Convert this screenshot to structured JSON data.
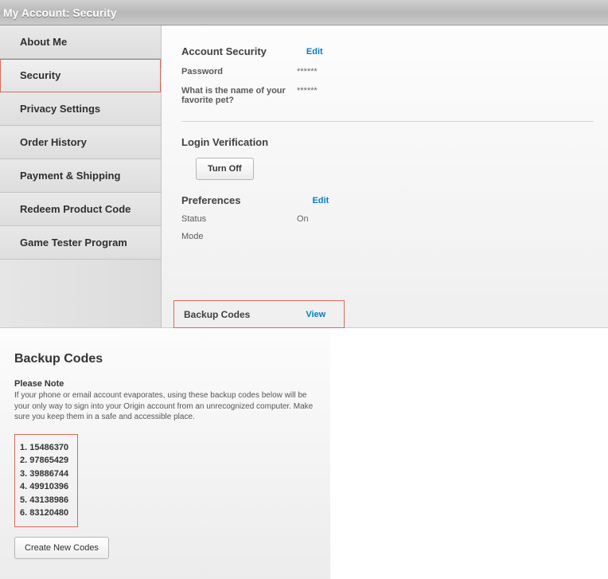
{
  "header": {
    "title": "My Account: Security"
  },
  "sidebar": {
    "items": [
      {
        "label": "About Me"
      },
      {
        "label": "Security"
      },
      {
        "label": "Privacy Settings"
      },
      {
        "label": "Order History"
      },
      {
        "label": "Payment & Shipping"
      },
      {
        "label": "Redeem Product Code"
      },
      {
        "label": "Game Tester Program"
      }
    ]
  },
  "account_security": {
    "title": "Account Security",
    "edit": "Edit",
    "password_label": "Password",
    "password_value": "******",
    "question_label": "What is the name of your favorite pet?",
    "question_value": "******"
  },
  "login_verification": {
    "title": "Login Verification",
    "turn_off": "Turn Off"
  },
  "preferences": {
    "title": "Preferences",
    "edit": "Edit",
    "status_label": "Status",
    "status_value": "On",
    "mode_label": "Mode"
  },
  "backup_row": {
    "title": "Backup Codes",
    "view": "View"
  },
  "backup_panel": {
    "title": "Backup Codes",
    "note_title": "Please Note",
    "note_body": "If your phone or email account evaporates, using these backup codes below will be your only way to sign into your Origin account from an unrecognized computer. Make sure you keep them in a safe and accessible place.",
    "codes": [
      "1. 15486370",
      "2. 97865429",
      "3. 39886744",
      "4. 49910396",
      "5. 43138986",
      "6. 83120480"
    ],
    "create_button": "Create New Codes"
  }
}
